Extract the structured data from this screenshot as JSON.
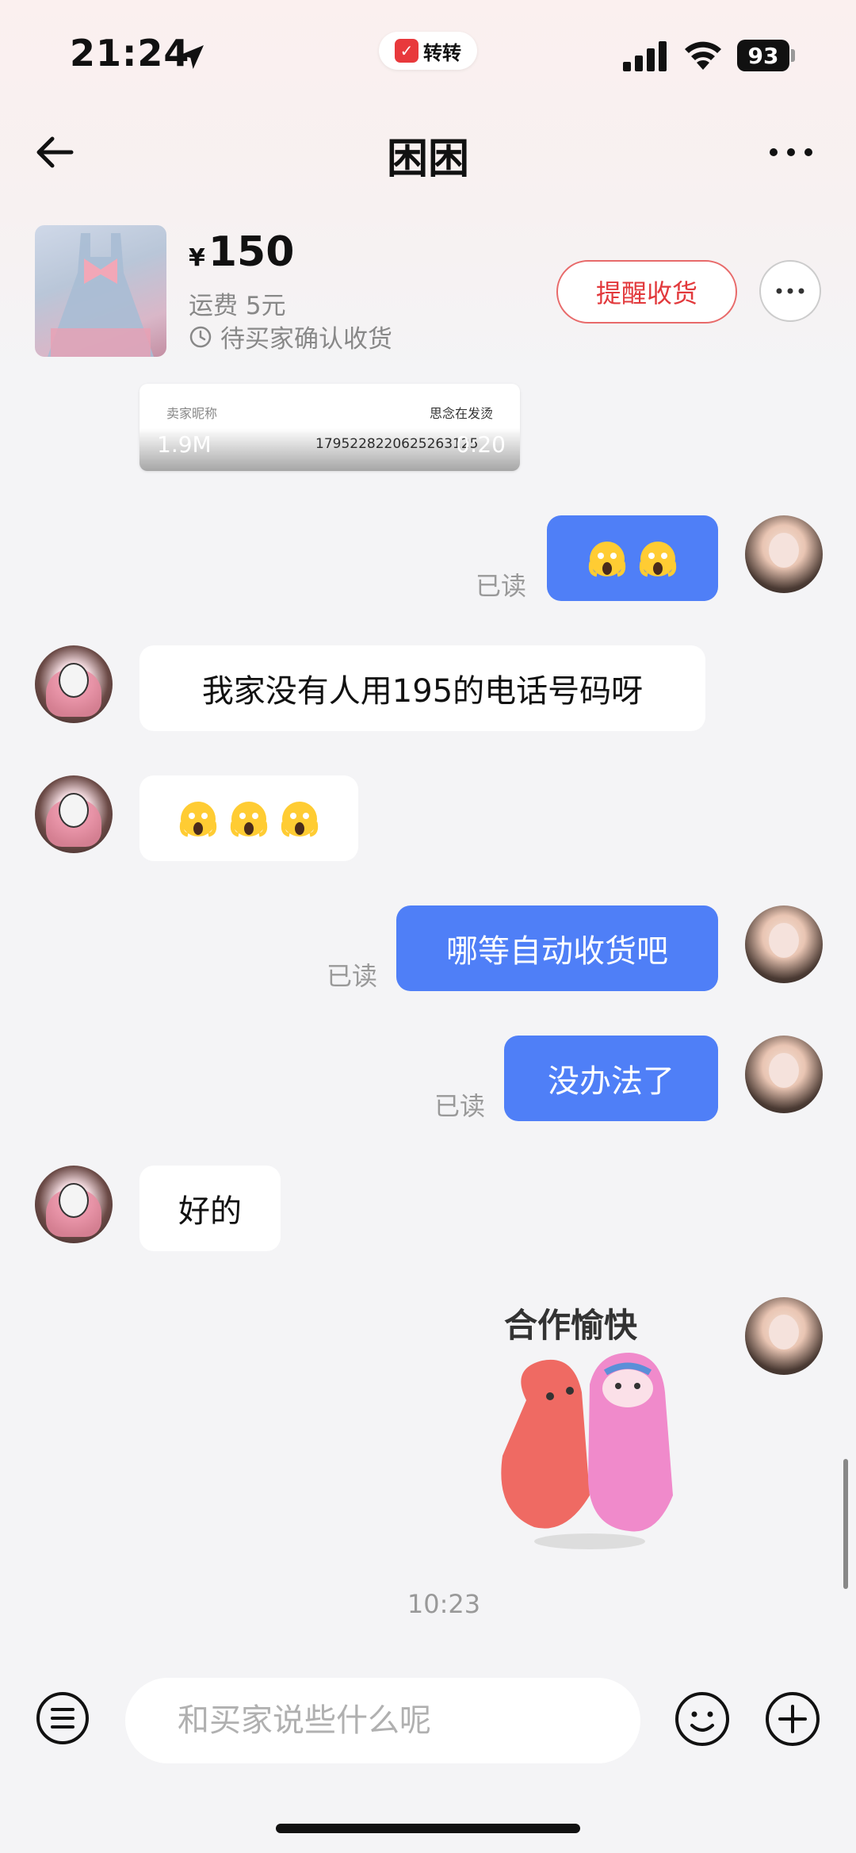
{
  "status_bar": {
    "time": "21:24",
    "app_name": "转转",
    "battery": "93"
  },
  "nav": {
    "title": "困困"
  },
  "product": {
    "currency": "¥",
    "price": "150",
    "shipping": "运费 5元",
    "status": "待买家确认收货",
    "remind_label": "提醒收货"
  },
  "partial_image": {
    "row_left": "卖家昵称",
    "row_right": "思念在发烫",
    "row_num": "1795228220625263125",
    "size": "1.9M",
    "duration": "0:20"
  },
  "messages": [
    {
      "side": "out",
      "type": "emoji",
      "emojis": [
        "scream",
        "scream"
      ],
      "read": "已读"
    },
    {
      "side": "in",
      "type": "text",
      "text": "我家没有人用195的电话号码呀"
    },
    {
      "side": "in",
      "type": "emoji",
      "emojis": [
        "scream",
        "scream",
        "scream"
      ]
    },
    {
      "side": "out",
      "type": "text",
      "text": "哪等自动收货吧",
      "read": "已读"
    },
    {
      "side": "out",
      "type": "text",
      "text": "没办法了",
      "read": "已读"
    },
    {
      "side": "in",
      "type": "text",
      "text": "好的"
    },
    {
      "side": "out",
      "type": "sticker",
      "sticker_text": "合作愉快"
    }
  ],
  "timestamp": "10:23",
  "input": {
    "placeholder": "和买家说些什么呢"
  },
  "colors": {
    "outgoing_bubble": "#4f7ff7",
    "incoming_bubble": "#ffffff",
    "accent_red": "#e2393c"
  }
}
